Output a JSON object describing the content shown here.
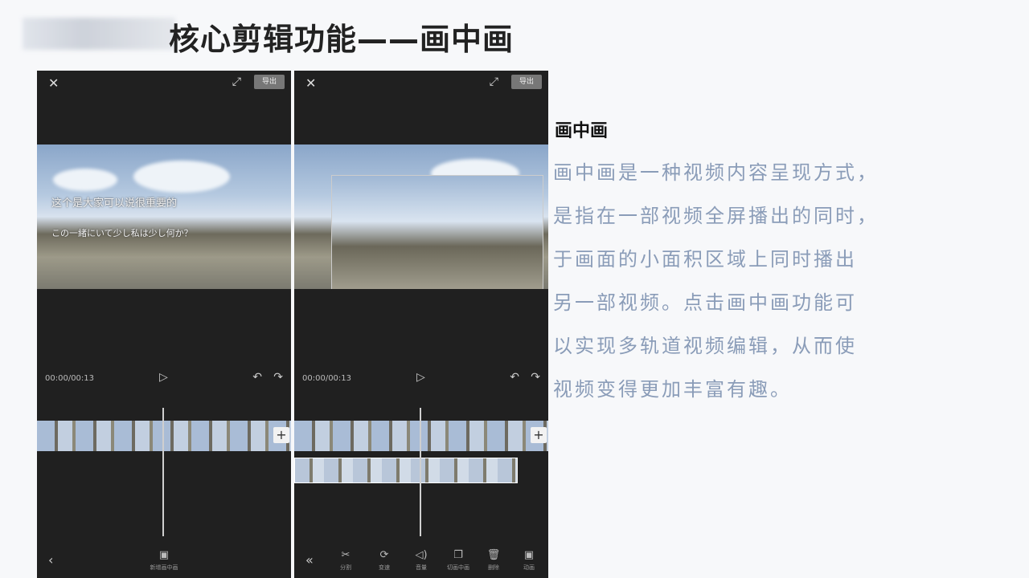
{
  "slide": {
    "title": "核心剪辑功能——画中画"
  },
  "left_phone": {
    "close_icon": "✕",
    "expand_icon": "⤢",
    "export_label": "导出",
    "subtitle_line1": "这个是大家可以说很重要的",
    "subtitle_line2": "この一緒にいて少し私は少し何か？",
    "timecode": "00:00/00:13",
    "play_icon": "▷",
    "undo_icon": "↶",
    "redo_icon": "↷",
    "add_icon": "+",
    "back_icon": "‹",
    "tool_label": "新增画中画",
    "tool_icon": "▣"
  },
  "right_phone": {
    "close_icon": "✕",
    "expand_icon": "⤢",
    "export_label": "导出",
    "timecode": "00:00/00:13",
    "play_icon": "▷",
    "undo_icon": "↶",
    "redo_icon": "↷",
    "add_icon": "+",
    "back_icon": "«",
    "tools": [
      {
        "icon": "✂",
        "label": "分割"
      },
      {
        "icon": "⟳",
        "label": "变速"
      },
      {
        "icon": "◁)",
        "label": "音量"
      },
      {
        "icon": "❐",
        "label": "切画中画"
      },
      {
        "icon": "🗑",
        "label": "删除"
      },
      {
        "icon": "▣",
        "label": "动画"
      }
    ]
  },
  "text_panel": {
    "heading": "画中画",
    "lines": [
      "画中画是一种视频内容呈现方式，",
      "是指在一部视频全屏播出的同时，",
      "于画面的小面积区域上同时播出",
      "另一部视频。点击画中画功能可",
      "以实现多轨道视频编辑，从而使",
      "视频变得更加丰富有趣。"
    ]
  }
}
